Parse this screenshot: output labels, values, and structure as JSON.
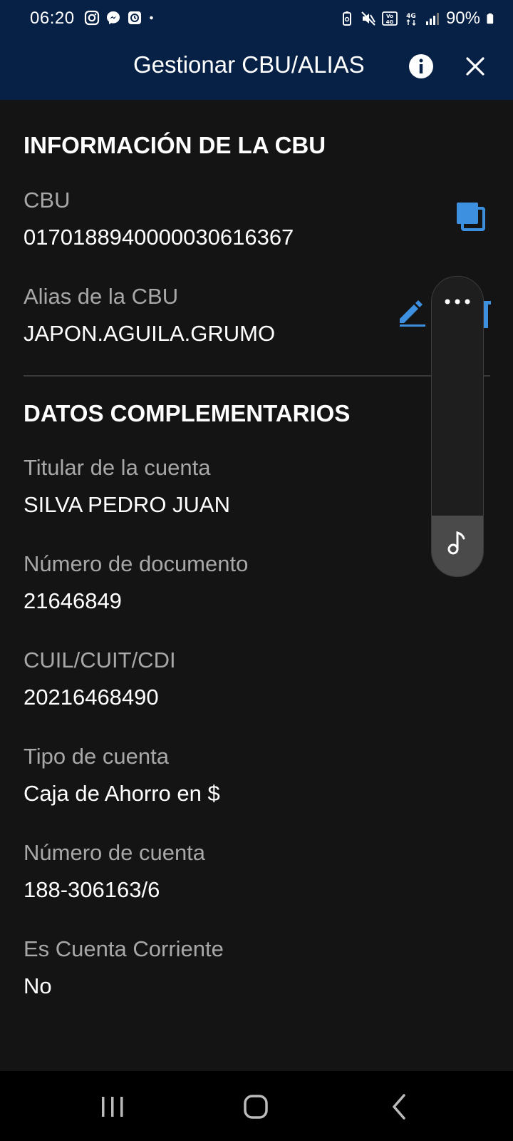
{
  "status_bar": {
    "time": "06:20",
    "battery": "90%",
    "left_icons": [
      "instagram-icon",
      "messenger-icon",
      "clock-app-icon",
      "dot-icon"
    ],
    "right_icons": [
      "battery-saver-icon",
      "mute-icon",
      "volte-icon",
      "4g-icon",
      "signal-icon",
      "battery-icon"
    ]
  },
  "header": {
    "title": "Gestionar CBU/ALIAS",
    "background": "#072146"
  },
  "cbu_info": {
    "section_title": "INFORMACIÓN DE LA CBU",
    "cbu_label": "CBU",
    "cbu_value": "0170188940000030616367",
    "alias_label": "Alias de la CBU",
    "alias_value": "JAPON.AGUILA.GRUMO"
  },
  "complementary": {
    "section_title": "DATOS COMPLEMENTARIOS",
    "fields": [
      {
        "label": "Titular de la cuenta",
        "value": "SILVA PEDRO JUAN"
      },
      {
        "label": "Número de documento",
        "value": "21646849"
      },
      {
        "label": "CUIL/CUIT/CDI",
        "value": "20216468490"
      },
      {
        "label": "Tipo de cuenta",
        "value": "Caja de Ahorro en $"
      },
      {
        "label": "Número de cuenta",
        "value": "188-306163/6"
      },
      {
        "label": "Es Cuenta Corriente",
        "value": "No"
      }
    ]
  },
  "colors": {
    "accent_blue": "#3d8fe0",
    "background": "#141414"
  },
  "floating_panel": {
    "icons": [
      "more-dots-icon",
      "music-note-icon"
    ]
  },
  "nav_bar": {
    "icons": [
      "recents-icon",
      "home-icon",
      "back-icon"
    ]
  }
}
